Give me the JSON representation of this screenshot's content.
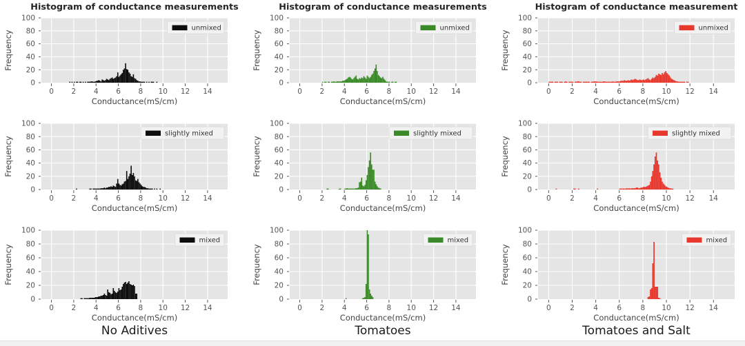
{
  "figure": {
    "background": "#ffffff",
    "panel_background": "#e5e5e5",
    "grid_color": "#ffffff",
    "tick_color": "#555555",
    "rows": 3,
    "cols": 3
  },
  "group_labels": [
    {
      "id": "col-1",
      "label": "No Aditives",
      "color": "#1a1a1a"
    },
    {
      "id": "col-2",
      "label": "Tomatoes",
      "color": "#1a1a1a"
    },
    {
      "id": "col-3",
      "label": "Tomatoes and Salt",
      "color": "#1a1a1a"
    }
  ],
  "series_colors": {
    "black": "#0d0d0d",
    "green": "#3a8a28",
    "red": "#e8382e"
  },
  "chart_data": [
    {
      "id": "panel-r1c1",
      "type": "bar",
      "title": "Histogram of conductance measurements",
      "xlabel": "Conductance(mS/cm)",
      "ylabel": "Frequency",
      "legend": "unmixed",
      "legend_position": "upper right",
      "color": "#0d0d0d",
      "grid": true,
      "xlim": [
        -0.9,
        15.8
      ],
      "ylim": [
        0,
        100
      ],
      "xticks": [
        0,
        2,
        4,
        6,
        8,
        10,
        12,
        14
      ],
      "yticks": [
        0,
        20,
        40,
        60,
        80,
        100
      ],
      "bin_width": 0.1,
      "bins_start": 1.6,
      "values": [
        1,
        0,
        1,
        0,
        1,
        0,
        1,
        1,
        0,
        1,
        1,
        0,
        1,
        0,
        1,
        0,
        1,
        1,
        1,
        2,
        2,
        1,
        1,
        2,
        3,
        3,
        4,
        3,
        2,
        5,
        4,
        3,
        4,
        6,
        5,
        4,
        6,
        7,
        8,
        6,
        7,
        8,
        10,
        16,
        9,
        11,
        13,
        15,
        20,
        22,
        30,
        21,
        20,
        16,
        14,
        10,
        9,
        13,
        7,
        6,
        4,
        3,
        2,
        2,
        1,
        1,
        1,
        1,
        0,
        1,
        0,
        1,
        0,
        1,
        1,
        1,
        0,
        0,
        1
      ]
    },
    {
      "id": "panel-r1c2",
      "type": "bar",
      "title": "Histogram of conductance measurements",
      "xlabel": "Conductance(mS/cm)",
      "ylabel": "Frequency",
      "legend": "unmixed",
      "legend_position": "upper right",
      "color": "#3a8a28",
      "grid": true,
      "xlim": [
        -0.9,
        15.8
      ],
      "ylim": [
        0,
        100
      ],
      "xticks": [
        0,
        2,
        4,
        6,
        8,
        10,
        12,
        14
      ],
      "yticks": [
        0,
        20,
        40,
        60,
        80,
        100
      ],
      "bin_width": 0.1,
      "bins_start": 2.0,
      "values": [
        1,
        0,
        1,
        1,
        0,
        1,
        1,
        0,
        1,
        1,
        2,
        1,
        1,
        2,
        2,
        2,
        2,
        2,
        3,
        3,
        4,
        5,
        6,
        8,
        9,
        8,
        6,
        5,
        7,
        9,
        11,
        6,
        5,
        7,
        6,
        8,
        7,
        10,
        8,
        6,
        11,
        9,
        7,
        9,
        12,
        14,
        18,
        22,
        28,
        18,
        12,
        10,
        8,
        7,
        9,
        6,
        4,
        2,
        1,
        1,
        1,
        0,
        1,
        1,
        0,
        1,
        1
      ]
    },
    {
      "id": "panel-r1c3",
      "type": "bar",
      "title": "Histogram of conductance measurement",
      "xlabel": "Conductance(mS/cm)",
      "ylabel": "Frequency",
      "legend": "unmixed",
      "legend_position": "upper right",
      "color": "#e8382e",
      "grid": true,
      "xlim": [
        -0.9,
        15.8
      ],
      "ylim": [
        0,
        100
      ],
      "xticks": [
        0,
        2,
        4,
        6,
        8,
        10,
        12,
        14
      ],
      "yticks": [
        0,
        20,
        40,
        60,
        80,
        100
      ],
      "bin_width": 0.1,
      "bins_start": 0.0,
      "values": [
        1,
        1,
        1,
        1,
        0,
        1,
        1,
        1,
        0,
        1,
        1,
        1,
        0,
        1,
        2,
        1,
        0,
        1,
        1,
        1,
        1,
        0,
        1,
        1,
        2,
        2,
        1,
        1,
        0,
        1,
        1,
        1,
        1,
        1,
        1,
        0,
        1,
        1,
        2,
        2,
        2,
        1,
        1,
        1,
        1,
        1,
        2,
        2,
        1,
        1,
        1,
        1,
        1,
        1,
        2,
        1,
        1,
        2,
        2,
        2,
        2,
        3,
        3,
        3,
        4,
        3,
        3,
        4,
        3,
        4,
        5,
        4,
        5,
        6,
        5,
        4,
        4,
        5,
        4,
        4,
        5,
        4,
        5,
        6,
        7,
        5,
        4,
        6,
        8,
        7,
        9,
        12,
        11,
        14,
        13,
        12,
        15,
        13,
        16,
        18,
        15,
        13,
        11,
        8,
        6,
        5,
        4,
        3,
        2,
        2,
        1,
        1,
        1,
        1,
        1,
        1,
        0,
        1,
        1
      ]
    },
    {
      "id": "panel-r2c1",
      "type": "bar",
      "title": "",
      "xlabel": "Conductance(mS/cm)",
      "ylabel": "Frequency",
      "legend": "slightly mixed",
      "legend_position": "upper right",
      "color": "#0d0d0d",
      "grid": true,
      "xlim": [
        -0.9,
        15.8
      ],
      "ylim": [
        0,
        100
      ],
      "xticks": [
        0,
        2,
        4,
        6,
        8,
        10,
        12,
        14
      ],
      "yticks": [
        0,
        20,
        40,
        60,
        80,
        100
      ],
      "bin_width": 0.1,
      "bins_start": 2.2,
      "values": [
        1,
        0,
        0,
        0,
        0,
        0,
        0,
        0,
        0,
        0,
        0,
        0,
        1,
        1,
        0,
        1,
        1,
        1,
        1,
        1,
        1,
        1,
        2,
        2,
        2,
        3,
        2,
        3,
        3,
        4,
        4,
        5,
        4,
        6,
        5,
        4,
        9,
        16,
        9,
        7,
        6,
        8,
        9,
        12,
        13,
        28,
        16,
        20,
        24,
        36,
        22,
        25,
        20,
        14,
        13,
        16,
        11,
        9,
        7,
        5,
        4,
        4,
        3,
        2,
        2,
        1,
        1,
        1,
        1,
        0,
        1,
        0,
        1,
        0,
        0,
        1
      ]
    },
    {
      "id": "panel-r2c2",
      "type": "bar",
      "title": "",
      "xlabel": "Conductance(mS/cm)",
      "ylabel": "Frequency",
      "legend": "slightly mixed",
      "legend_position": "upper right",
      "color": "#3a8a28",
      "grid": true,
      "xlim": [
        -0.9,
        15.8
      ],
      "ylim": [
        0,
        100
      ],
      "xticks": [
        0,
        2,
        4,
        6,
        8,
        10,
        12,
        14
      ],
      "yticks": [
        0,
        20,
        40,
        60,
        80,
        100
      ],
      "bin_width": 0.1,
      "bins_start": 2.4,
      "values": [
        1,
        1,
        0,
        0,
        0,
        0,
        0,
        0,
        0,
        0,
        0,
        1,
        1,
        0,
        0,
        0,
        1,
        1,
        2,
        1,
        1,
        1,
        1,
        1,
        1,
        1,
        2,
        2,
        3,
        11,
        12,
        18,
        6,
        5,
        7,
        14,
        22,
        34,
        44,
        56,
        38,
        30,
        30,
        12,
        8,
        5,
        3,
        2,
        1
      ]
    },
    {
      "id": "panel-r2c3",
      "type": "bar",
      "title": "",
      "xlabel": "Conductance(mS/cm)",
      "ylabel": "Frequency",
      "legend": "slightly mixed",
      "legend_position": "upper right",
      "color": "#e8382e",
      "grid": true,
      "xlim": [
        -0.9,
        15.8
      ],
      "ylim": [
        0,
        100
      ],
      "xticks": [
        0,
        2,
        4,
        6,
        8,
        10,
        12,
        14
      ],
      "yticks": [
        0,
        20,
        40,
        60,
        80,
        100
      ],
      "bin_width": 0.1,
      "bins_start": 0.6,
      "values": [
        1,
        0,
        0,
        0,
        0,
        0,
        0,
        0,
        0,
        0,
        0,
        0,
        0,
        0,
        0,
        1,
        1,
        0,
        0,
        1,
        0,
        0,
        0,
        0,
        0,
        0,
        0,
        0,
        0,
        0,
        0,
        0,
        0,
        0,
        0,
        1,
        0,
        0,
        0,
        0,
        0,
        0,
        0,
        0,
        0,
        0,
        0,
        0,
        0,
        0,
        0,
        0,
        0,
        0,
        1,
        1,
        1,
        1,
        1,
        1,
        2,
        1,
        2,
        1,
        2,
        2,
        2,
        2,
        3,
        3,
        2,
        2,
        3,
        3,
        4,
        4,
        4,
        5,
        6,
        7,
        12,
        20,
        28,
        38,
        50,
        56,
        44,
        38,
        26,
        18,
        12,
        9,
        7,
        5,
        4,
        3,
        2,
        2,
        1,
        1
      ]
    },
    {
      "id": "panel-r3c1",
      "type": "bar",
      "title": "",
      "xlabel": "Conductance(mS/cm)",
      "ylabel": "Frequency",
      "legend": "mixed",
      "legend_position": "upper right",
      "color": "#0d0d0d",
      "grid": true,
      "xlim": [
        -0.9,
        15.8
      ],
      "ylim": [
        0,
        100
      ],
      "xticks": [
        0,
        2,
        4,
        6,
        8,
        10,
        12,
        14
      ],
      "yticks": [
        0,
        20,
        40,
        60,
        80,
        100
      ],
      "bin_width": 0.1,
      "bins_start": 2.6,
      "values": [
        1,
        1,
        0,
        1,
        1,
        1,
        1,
        1,
        2,
        2,
        2,
        2,
        2,
        3,
        3,
        3,
        4,
        4,
        5,
        5,
        6,
        8,
        6,
        5,
        14,
        10,
        9,
        7,
        8,
        16,
        12,
        10,
        9,
        11,
        16,
        13,
        14,
        18,
        22,
        24,
        25,
        22,
        24,
        26,
        22,
        21,
        20,
        21,
        19,
        8,
        8
      ]
    },
    {
      "id": "panel-r3c2",
      "type": "bar",
      "title": "",
      "xlabel": "Conductance(mS/cm)",
      "ylabel": "Frequency",
      "legend": "mixed",
      "legend_position": "upper right",
      "color": "#3a8a28",
      "grid": true,
      "xlim": [
        -0.9,
        15.8
      ],
      "ylim": [
        0,
        100
      ],
      "xticks": [
        0,
        2,
        4,
        6,
        8,
        10,
        12,
        14
      ],
      "yticks": [
        0,
        20,
        40,
        60,
        80,
        100
      ],
      "bin_width": 0.1,
      "bins_start": 4.1,
      "values": [
        1,
        0,
        0,
        0,
        0,
        0,
        0,
        0,
        0,
        0,
        0,
        0,
        0,
        0,
        0,
        1,
        2,
        3,
        22,
        100,
        94,
        14,
        8,
        5,
        3
      ]
    },
    {
      "id": "panel-r3c3",
      "type": "bar",
      "title": "",
      "xlabel": "Conductance(mS/cm)",
      "ylabel": "Frequency",
      "legend": "mixed",
      "legend_position": "upper right",
      "color": "#e8382e",
      "grid": true,
      "xlim": [
        -0.9,
        15.8
      ],
      "ylim": [
        0,
        100
      ],
      "xticks": [
        0,
        2,
        4,
        6,
        8,
        10,
        12,
        14
      ],
      "yticks": [
        0,
        20,
        40,
        60,
        80,
        100
      ],
      "bin_width": 0.1,
      "bins_start": 8.4,
      "values": [
        3,
        4,
        14,
        16,
        52,
        83,
        18,
        18,
        18,
        2,
        1
      ]
    }
  ]
}
